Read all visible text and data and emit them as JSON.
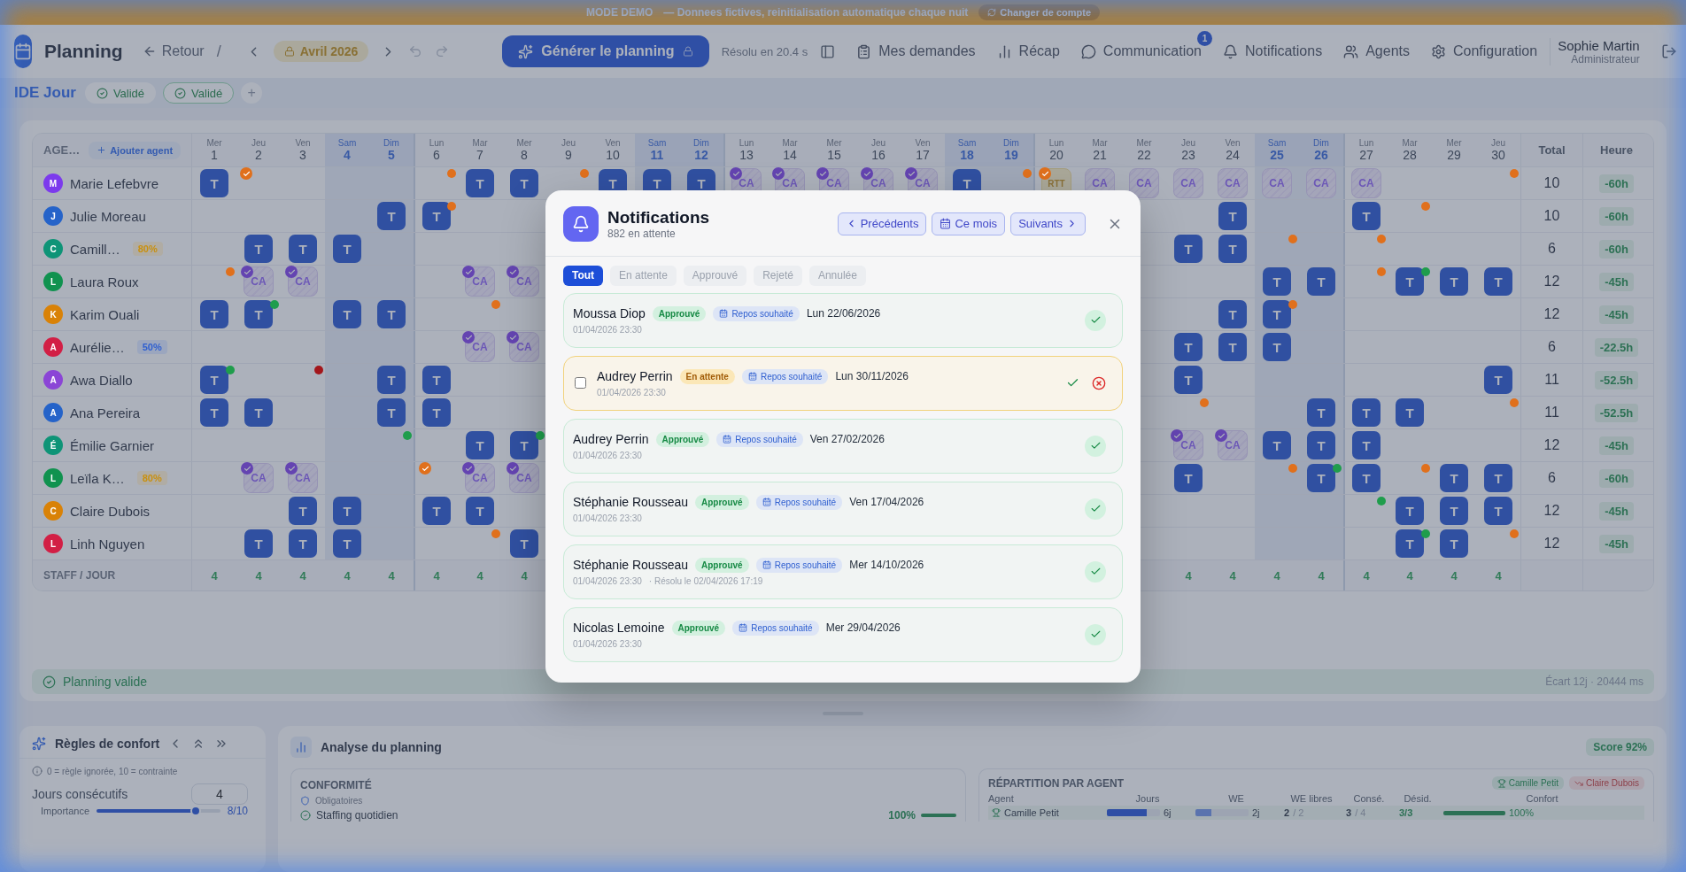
{
  "banner": {
    "mode": "MODE DEMO",
    "message": "— Donnees fictives, reinitialisation automatique chaque nuit",
    "switch_button": "Changer de compte"
  },
  "header": {
    "title": "Planning",
    "back": "Retour",
    "separator": "/",
    "month": "Avril",
    "year": "2026",
    "generate_button": "Générer le planning",
    "solve_time": "Résolu en 20.4 s",
    "nav": [
      {
        "kind": "requests",
        "label": "Mes demandes"
      },
      {
        "kind": "recap",
        "label": "Récap"
      },
      {
        "kind": "messages",
        "label": "Communication",
        "badge": "1"
      },
      {
        "kind": "notifications",
        "label": "Notifications"
      },
      {
        "kind": "agents",
        "label": "Agents"
      },
      {
        "kind": "settings",
        "label": "Configuration"
      }
    ],
    "user": {
      "name": "Sophie Martin",
      "role": "Administrateur"
    }
  },
  "team": {
    "name": "IDE Jour",
    "chips": [
      {
        "label": "Validé",
        "selected": false
      },
      {
        "label": "Validé",
        "selected": true
      }
    ],
    "add_button": "+"
  },
  "grid": {
    "agent_header": "AGE…",
    "add_agent": "Ajouter agent",
    "total_header": "Total",
    "hours_header": "Heure",
    "staff_label": "STAFF / JOUR",
    "days": [
      {
        "weekday": "Mer",
        "day": "1",
        "weekend": false
      },
      {
        "weekday": "Jeu",
        "day": "2",
        "weekend": false
      },
      {
        "weekday": "Ven",
        "day": "3",
        "weekend": false
      },
      {
        "weekday": "Sam",
        "day": "4",
        "weekend": true
      },
      {
        "weekday": "Dim",
        "day": "5",
        "weekend": true
      },
      {
        "weekday": "Lun",
        "day": "6",
        "weekend": false
      },
      {
        "weekday": "Mar",
        "day": "7",
        "weekend": false
      },
      {
        "weekday": "Mer",
        "day": "8",
        "weekend": false
      },
      {
        "weekday": "Jeu",
        "day": "9",
        "weekend": false
      },
      {
        "weekday": "Ven",
        "day": "10",
        "weekend": false
      },
      {
        "weekday": "Sam",
        "day": "11",
        "weekend": true
      },
      {
        "weekday": "Dim",
        "day": "12",
        "weekend": true
      },
      {
        "weekday": "Lun",
        "day": "13",
        "weekend": false
      },
      {
        "weekday": "Mar",
        "day": "14",
        "weekend": false
      },
      {
        "weekday": "Mer",
        "day": "15",
        "weekend": false
      },
      {
        "weekday": "Jeu",
        "day": "16",
        "weekend": false
      },
      {
        "weekday": "Ven",
        "day": "17",
        "weekend": false
      },
      {
        "weekday": "Sam",
        "day": "18",
        "weekend": true
      },
      {
        "weekday": "Dim",
        "day": "19",
        "weekend": true
      },
      {
        "weekday": "Lun",
        "day": "20",
        "weekend": false
      },
      {
        "weekday": "Mar",
        "day": "21",
        "weekend": false
      },
      {
        "weekday": "Mer",
        "day": "22",
        "weekend": false
      },
      {
        "weekday": "Jeu",
        "day": "23",
        "weekend": false
      },
      {
        "weekday": "Ven",
        "day": "24",
        "weekend": false
      },
      {
        "weekday": "Sam",
        "day": "25",
        "weekend": true
      },
      {
        "weekday": "Dim",
        "day": "26",
        "weekend": true
      },
      {
        "weekday": "Lun",
        "day": "27",
        "weekend": false
      },
      {
        "weekday": "Mar",
        "day": "28",
        "weekend": false
      },
      {
        "weekday": "Mer",
        "day": "29",
        "weekend": false
      },
      {
        "weekday": "Jeu",
        "day": "30",
        "weekend": false
      }
    ],
    "agents": [
      {
        "initial": "M",
        "color": "#7c3aed",
        "name": "Marie Lefebvre",
        "total": "10",
        "hours": "-60h",
        "cells": [
          {
            "kind": "work",
            "label": "T"
          },
          {
            "kind": "off",
            "dot": {
              "color": "#e0701c",
              "checked": true
            }
          },
          {
            "kind": "off"
          },
          {
            "kind": "off"
          },
          {
            "kind": "off"
          },
          {
            "kind": "off",
            "dot": {
              "color": "#e0701c",
              "checked": false
            }
          },
          {
            "kind": "work",
            "label": "T"
          },
          {
            "kind": "work",
            "label": "T"
          },
          {
            "kind": "off",
            "dot": {
              "color": "#e0701c",
              "checked": false
            }
          },
          {
            "kind": "work",
            "label": "T"
          },
          {
            "kind": "work",
            "label": "T"
          },
          {
            "kind": "work",
            "label": "T"
          },
          {
            "kind": "leave",
            "label": "CA",
            "approved": true
          },
          {
            "kind": "leave",
            "label": "CA",
            "approved": true
          },
          {
            "kind": "leave",
            "label": "CA",
            "approved": true
          },
          {
            "kind": "leave",
            "label": "CA",
            "approved": true
          },
          {
            "kind": "leave",
            "label": "CA",
            "approved": true
          },
          {
            "kind": "work",
            "label": "T"
          },
          {
            "kind": "off",
            "dot": {
              "color": "#e0701c",
              "checked": false
            }
          },
          {
            "kind": "rtt",
            "label": "RTT",
            "dot": {
              "color": "#e0701c",
              "checked": true
            }
          },
          {
            "kind": "leave",
            "label": "CA",
            "approved": false
          },
          {
            "kind": "leave",
            "label": "CA",
            "approved": false
          },
          {
            "kind": "leave",
            "label": "CA",
            "approved": false
          },
          {
            "kind": "leave",
            "label": "CA",
            "approved": false
          },
          {
            "kind": "leave",
            "label": "CA",
            "approved": false
          },
          {
            "kind": "leave",
            "label": "CA",
            "approved": false
          },
          {
            "kind": "leave",
            "label": "CA",
            "approved": false
          },
          {
            "kind": "off"
          },
          {
            "kind": "off"
          },
          {
            "kind": "off",
            "dot": {
              "color": "#e0701c",
              "checked": false
            }
          }
        ]
      },
      {
        "initial": "J",
        "color": "#2563c9",
        "name": "Julie Moreau",
        "total": "10",
        "hours": "-60h",
        "cells": [
          {
            "kind": "off"
          },
          {
            "kind": "off"
          },
          {
            "kind": "off"
          },
          {
            "kind": "off"
          },
          {
            "kind": "work",
            "label": "T"
          },
          {
            "kind": "work",
            "label": "T",
            "dot": {
              "color": "#e0701c",
              "checked": false
            }
          },
          {
            "kind": "off"
          },
          {
            "kind": "off"
          },
          {
            "kind": "covered"
          },
          {
            "kind": "covered"
          },
          {
            "kind": "covered"
          },
          {
            "kind": "covered"
          },
          {
            "kind": "covered"
          },
          {
            "kind": "covered"
          },
          {
            "kind": "covered"
          },
          {
            "kind": "covered"
          },
          {
            "kind": "covered"
          },
          {
            "kind": "covered"
          },
          {
            "kind": "covered"
          },
          {
            "kind": "covered"
          },
          {
            "kind": "covered"
          },
          {
            "kind": "covered"
          },
          {
            "kind": "off"
          },
          {
            "kind": "work",
            "label": "T"
          },
          {
            "kind": "off"
          },
          {
            "kind": "off"
          },
          {
            "kind": "work",
            "label": "T"
          },
          {
            "kind": "off",
            "dot": {
              "color": "#e0701c",
              "checked": false
            }
          },
          {
            "kind": "off"
          },
          {
            "kind": "off"
          }
        ]
      },
      {
        "initial": "C",
        "color": "#0e9477",
        "name": "Camill…",
        "rate": {
          "label": "80%",
          "color": "#c9900e"
        },
        "total": "6",
        "hours": "-60h",
        "cells": [
          {
            "kind": "off"
          },
          {
            "kind": "work",
            "label": "T"
          },
          {
            "kind": "work",
            "label": "T"
          },
          {
            "kind": "work",
            "label": "T"
          },
          {
            "kind": "off"
          },
          {
            "kind": "off"
          },
          {
            "kind": "off"
          },
          {
            "kind": "off"
          },
          {
            "kind": "covered"
          },
          {
            "kind": "covered"
          },
          {
            "kind": "covered"
          },
          {
            "kind": "covered"
          },
          {
            "kind": "covered"
          },
          {
            "kind": "covered"
          },
          {
            "kind": "covered"
          },
          {
            "kind": "covered"
          },
          {
            "kind": "covered"
          },
          {
            "kind": "covered"
          },
          {
            "kind": "covered"
          },
          {
            "kind": "covered"
          },
          {
            "kind": "covered"
          },
          {
            "kind": "covered"
          },
          {
            "kind": "work",
            "label": "T"
          },
          {
            "kind": "work",
            "label": "T"
          },
          {
            "kind": "off",
            "dot": {
              "color": "#e0701c",
              "checked": false
            }
          },
          {
            "kind": "off"
          },
          {
            "kind": "off",
            "dot": {
              "color": "#e0701c",
              "checked": false
            }
          },
          {
            "kind": "off"
          },
          {
            "kind": "off"
          },
          {
            "kind": "off"
          }
        ]
      },
      {
        "initial": "L",
        "color": "#10924f",
        "name": "Laura Roux",
        "total": "12",
        "hours": "-45h",
        "cells": [
          {
            "kind": "off",
            "dot": {
              "color": "#e0701c",
              "checked": false
            }
          },
          {
            "kind": "leave",
            "label": "CA",
            "approved": true
          },
          {
            "kind": "leave",
            "label": "CA",
            "approved": true
          },
          {
            "kind": "off"
          },
          {
            "kind": "off"
          },
          {
            "kind": "off"
          },
          {
            "kind": "leave",
            "label": "CA",
            "approved": true
          },
          {
            "kind": "leave",
            "label": "CA",
            "approved": true
          },
          {
            "kind": "covered"
          },
          {
            "kind": "covered"
          },
          {
            "kind": "covered"
          },
          {
            "kind": "covered"
          },
          {
            "kind": "covered"
          },
          {
            "kind": "covered"
          },
          {
            "kind": "covered"
          },
          {
            "kind": "covered"
          },
          {
            "kind": "covered"
          },
          {
            "kind": "covered"
          },
          {
            "kind": "covered"
          },
          {
            "kind": "covered"
          },
          {
            "kind": "covered"
          },
          {
            "kind": "covered"
          },
          {
            "kind": "off"
          },
          {
            "kind": "off"
          },
          {
            "kind": "work",
            "label": "T"
          },
          {
            "kind": "work",
            "label": "T"
          },
          {
            "kind": "off",
            "dot": {
              "color": "#e0701c",
              "checked": false
            }
          },
          {
            "kind": "work",
            "label": "T",
            "dot": {
              "color": "#1f9d4c",
              "checked": false
            }
          },
          {
            "kind": "work",
            "label": "T"
          },
          {
            "kind": "work",
            "label": "T"
          }
        ]
      },
      {
        "initial": "K",
        "color": "#d98207",
        "name": "Karim Ouali",
        "total": "12",
        "hours": "-45h",
        "cells": [
          {
            "kind": "work",
            "label": "T"
          },
          {
            "kind": "work",
            "label": "T",
            "dot": {
              "color": "#1f9d4c",
              "checked": false
            }
          },
          {
            "kind": "off"
          },
          {
            "kind": "work",
            "label": "T"
          },
          {
            "kind": "work",
            "label": "T"
          },
          {
            "kind": "off"
          },
          {
            "kind": "off",
            "dot": {
              "color": "#e0701c",
              "checked": false
            }
          },
          {
            "kind": "off"
          },
          {
            "kind": "covered"
          },
          {
            "kind": "covered"
          },
          {
            "kind": "covered"
          },
          {
            "kind": "covered"
          },
          {
            "kind": "covered"
          },
          {
            "kind": "covered"
          },
          {
            "kind": "covered"
          },
          {
            "kind": "covered"
          },
          {
            "kind": "covered"
          },
          {
            "kind": "covered"
          },
          {
            "kind": "covered"
          },
          {
            "kind": "covered"
          },
          {
            "kind": "covered"
          },
          {
            "kind": "covered"
          },
          {
            "kind": "off"
          },
          {
            "kind": "work",
            "label": "T"
          },
          {
            "kind": "work",
            "label": "T",
            "dot": {
              "color": "#e0701c",
              "checked": false
            }
          },
          {
            "kind": "off"
          },
          {
            "kind": "off"
          },
          {
            "kind": "off"
          },
          {
            "kind": "off"
          },
          {
            "kind": "off"
          }
        ]
      },
      {
        "initial": "A",
        "color": "#d21f45",
        "name": "Aurélie…",
        "rate": {
          "label": "50%",
          "color": "#2f5fd0"
        },
        "total": "6",
        "hours": "-22.5h",
        "cells": [
          {
            "kind": "off"
          },
          {
            "kind": "off"
          },
          {
            "kind": "off"
          },
          {
            "kind": "off"
          },
          {
            "kind": "off"
          },
          {
            "kind": "off"
          },
          {
            "kind": "leave",
            "label": "CA",
            "approved": true
          },
          {
            "kind": "leave",
            "label": "CA",
            "approved": true
          },
          {
            "kind": "covered"
          },
          {
            "kind": "covered"
          },
          {
            "kind": "covered"
          },
          {
            "kind": "covered"
          },
          {
            "kind": "covered"
          },
          {
            "kind": "covered"
          },
          {
            "kind": "covered"
          },
          {
            "kind": "covered"
          },
          {
            "kind": "covered"
          },
          {
            "kind": "covered"
          },
          {
            "kind": "covered"
          },
          {
            "kind": "covered"
          },
          {
            "kind": "covered"
          },
          {
            "kind": "covered"
          },
          {
            "kind": "work",
            "label": "T"
          },
          {
            "kind": "work",
            "label": "T"
          },
          {
            "kind": "work",
            "label": "T"
          },
          {
            "kind": "off"
          },
          {
            "kind": "off"
          },
          {
            "kind": "off"
          },
          {
            "kind": "off"
          },
          {
            "kind": "off"
          }
        ]
      },
      {
        "initial": "A",
        "color": "#8b45d6",
        "name": "Awa Diallo",
        "total": "11",
        "hours": "-52.5h",
        "cells": [
          {
            "kind": "work",
            "label": "T",
            "dot": {
              "color": "#1f9d4c",
              "checked": false
            }
          },
          {
            "kind": "off"
          },
          {
            "kind": "off",
            "dot": {
              "color": "#a3161b",
              "checked": false
            }
          },
          {
            "kind": "off"
          },
          {
            "kind": "work",
            "label": "T"
          },
          {
            "kind": "work",
            "label": "T"
          },
          {
            "kind": "off"
          },
          {
            "kind": "off"
          },
          {
            "kind": "covered"
          },
          {
            "kind": "covered"
          },
          {
            "kind": "covered"
          },
          {
            "kind": "covered"
          },
          {
            "kind": "covered"
          },
          {
            "kind": "covered"
          },
          {
            "kind": "covered"
          },
          {
            "kind": "covered"
          },
          {
            "kind": "covered"
          },
          {
            "kind": "covered"
          },
          {
            "kind": "covered"
          },
          {
            "kind": "covered"
          },
          {
            "kind": "covered"
          },
          {
            "kind": "covered"
          },
          {
            "kind": "work",
            "label": "T"
          },
          {
            "kind": "off"
          },
          {
            "kind": "off"
          },
          {
            "kind": "off"
          },
          {
            "kind": "off"
          },
          {
            "kind": "off"
          },
          {
            "kind": "off"
          },
          {
            "kind": "work",
            "label": "T"
          }
        ]
      },
      {
        "initial": "A",
        "color": "#2563c9",
        "name": "Ana Pereira",
        "total": "11",
        "hours": "-52.5h",
        "cells": [
          {
            "kind": "work",
            "label": "T"
          },
          {
            "kind": "work",
            "label": "T"
          },
          {
            "kind": "off"
          },
          {
            "kind": "off"
          },
          {
            "kind": "work",
            "label": "T"
          },
          {
            "kind": "work",
            "label": "T"
          },
          {
            "kind": "off"
          },
          {
            "kind": "off"
          },
          {
            "kind": "covered"
          },
          {
            "kind": "covered"
          },
          {
            "kind": "covered"
          },
          {
            "kind": "covered"
          },
          {
            "kind": "covered"
          },
          {
            "kind": "covered"
          },
          {
            "kind": "covered"
          },
          {
            "kind": "covered"
          },
          {
            "kind": "covered"
          },
          {
            "kind": "covered"
          },
          {
            "kind": "covered"
          },
          {
            "kind": "covered"
          },
          {
            "kind": "covered"
          },
          {
            "kind": "covered"
          },
          {
            "kind": "off",
            "dot": {
              "color": "#e0701c",
              "checked": false
            }
          },
          {
            "kind": "off"
          },
          {
            "kind": "off"
          },
          {
            "kind": "work",
            "label": "T"
          },
          {
            "kind": "work",
            "label": "T"
          },
          {
            "kind": "work",
            "label": "T"
          },
          {
            "kind": "off"
          },
          {
            "kind": "off",
            "dot": {
              "color": "#e0701c",
              "checked": false
            }
          }
        ]
      },
      {
        "initial": "É",
        "color": "#0e9477",
        "name": "Émilie Garnier",
        "total": "12",
        "hours": "-45h",
        "cells": [
          {
            "kind": "off"
          },
          {
            "kind": "off"
          },
          {
            "kind": "off"
          },
          {
            "kind": "off"
          },
          {
            "kind": "off",
            "dot": {
              "color": "#1f9d4c",
              "checked": false
            }
          },
          {
            "kind": "off"
          },
          {
            "kind": "work",
            "label": "T"
          },
          {
            "kind": "work",
            "label": "T",
            "dot": {
              "color": "#1f9d4c",
              "checked": false
            }
          },
          {
            "kind": "covered"
          },
          {
            "kind": "covered"
          },
          {
            "kind": "covered"
          },
          {
            "kind": "covered"
          },
          {
            "kind": "covered"
          },
          {
            "kind": "covered"
          },
          {
            "kind": "covered"
          },
          {
            "kind": "covered"
          },
          {
            "kind": "covered"
          },
          {
            "kind": "covered"
          },
          {
            "kind": "covered"
          },
          {
            "kind": "covered"
          },
          {
            "kind": "covered"
          },
          {
            "kind": "covered"
          },
          {
            "kind": "leave",
            "label": "CA",
            "approved": true
          },
          {
            "kind": "leave",
            "label": "CA",
            "approved": true
          },
          {
            "kind": "work",
            "label": "T"
          },
          {
            "kind": "work",
            "label": "T"
          },
          {
            "kind": "work",
            "label": "T"
          },
          {
            "kind": "off"
          },
          {
            "kind": "off"
          },
          {
            "kind": "off"
          }
        ]
      },
      {
        "initial": "L",
        "color": "#10924f",
        "name": "Leïla K…",
        "rate": {
          "label": "80%",
          "color": "#c9900e"
        },
        "total": "6",
        "hours": "-60h",
        "cells": [
          {
            "kind": "off"
          },
          {
            "kind": "leave",
            "label": "CA",
            "approved": true
          },
          {
            "kind": "leave",
            "label": "CA",
            "approved": true
          },
          {
            "kind": "off"
          },
          {
            "kind": "off"
          },
          {
            "kind": "off",
            "dot": {
              "color": "#e0701c",
              "checked": true
            }
          },
          {
            "kind": "leave",
            "label": "CA",
            "approved": true
          },
          {
            "kind": "leave",
            "label": "CA",
            "approved": true
          },
          {
            "kind": "covered"
          },
          {
            "kind": "covered"
          },
          {
            "kind": "covered"
          },
          {
            "kind": "covered"
          },
          {
            "kind": "covered"
          },
          {
            "kind": "covered"
          },
          {
            "kind": "covered"
          },
          {
            "kind": "covered"
          },
          {
            "kind": "covered"
          },
          {
            "kind": "covered"
          },
          {
            "kind": "covered"
          },
          {
            "kind": "covered"
          },
          {
            "kind": "covered"
          },
          {
            "kind": "covered"
          },
          {
            "kind": "work",
            "label": "T"
          },
          {
            "kind": "off"
          },
          {
            "kind": "off",
            "dot": {
              "color": "#e0701c",
              "checked": false
            }
          },
          {
            "kind": "work",
            "label": "T",
            "dot": {
              "color": "#1f9d4c",
              "checked": false
            }
          },
          {
            "kind": "work",
            "label": "T"
          },
          {
            "kind": "off",
            "dot": {
              "color": "#e0701c",
              "checked": false
            }
          },
          {
            "kind": "work",
            "label": "T"
          },
          {
            "kind": "work",
            "label": "T"
          }
        ]
      },
      {
        "initial": "C",
        "color": "#d98207",
        "name": "Claire Dubois",
        "total": "12",
        "hours": "-45h",
        "cells": [
          {
            "kind": "off"
          },
          {
            "kind": "off"
          },
          {
            "kind": "work",
            "label": "T"
          },
          {
            "kind": "work",
            "label": "T"
          },
          {
            "kind": "off"
          },
          {
            "kind": "work",
            "label": "T"
          },
          {
            "kind": "work",
            "label": "T"
          },
          {
            "kind": "off"
          },
          {
            "kind": "covered"
          },
          {
            "kind": "covered"
          },
          {
            "kind": "covered"
          },
          {
            "kind": "covered"
          },
          {
            "kind": "covered"
          },
          {
            "kind": "covered"
          },
          {
            "kind": "covered"
          },
          {
            "kind": "covered"
          },
          {
            "kind": "covered"
          },
          {
            "kind": "covered"
          },
          {
            "kind": "covered"
          },
          {
            "kind": "covered"
          },
          {
            "kind": "covered"
          },
          {
            "kind": "covered"
          },
          {
            "kind": "off"
          },
          {
            "kind": "off"
          },
          {
            "kind": "off"
          },
          {
            "kind": "off"
          },
          {
            "kind": "off",
            "dot": {
              "color": "#1f9d4c",
              "checked": false
            }
          },
          {
            "kind": "work",
            "label": "T"
          },
          {
            "kind": "work",
            "label": "T"
          },
          {
            "kind": "work",
            "label": "T"
          }
        ]
      },
      {
        "initial": "L",
        "color": "#d21f45",
        "name": "Linh Nguyen",
        "total": "12",
        "hours": "-45h",
        "cells": [
          {
            "kind": "off"
          },
          {
            "kind": "work",
            "label": "T"
          },
          {
            "kind": "work",
            "label": "T"
          },
          {
            "kind": "work",
            "label": "T"
          },
          {
            "kind": "off"
          },
          {
            "kind": "off"
          },
          {
            "kind": "off",
            "dot": {
              "color": "#e0701c",
              "checked": false
            }
          },
          {
            "kind": "work",
            "label": "T"
          },
          {
            "kind": "covered"
          },
          {
            "kind": "covered"
          },
          {
            "kind": "covered"
          },
          {
            "kind": "covered"
          },
          {
            "kind": "covered"
          },
          {
            "kind": "covered"
          },
          {
            "kind": "covered"
          },
          {
            "kind": "covered"
          },
          {
            "kind": "covered"
          },
          {
            "kind": "covered"
          },
          {
            "kind": "covered"
          },
          {
            "kind": "covered"
          },
          {
            "kind": "covered"
          },
          {
            "kind": "covered"
          },
          {
            "kind": "off"
          },
          {
            "kind": "off"
          },
          {
            "kind": "off"
          },
          {
            "kind": "off"
          },
          {
            "kind": "off"
          },
          {
            "kind": "work",
            "label": "T",
            "dot": {
              "color": "#1f9d4c",
              "checked": false
            }
          },
          {
            "kind": "work",
            "label": "T"
          },
          {
            "kind": "off",
            "dot": {
              "color": "#e0701c",
              "checked": false
            }
          }
        ]
      }
    ],
    "staff": [
      {
        "kind": "count",
        "value": "4"
      },
      {
        "kind": "count",
        "value": "4"
      },
      {
        "kind": "count",
        "value": "4"
      },
      {
        "kind": "count",
        "value": "4"
      },
      {
        "kind": "count",
        "value": "4"
      },
      {
        "kind": "count",
        "value": "4"
      },
      {
        "kind": "count",
        "value": "4"
      },
      {
        "kind": "count",
        "value": "4"
      },
      {
        "kind": "covered"
      },
      {
        "kind": "covered"
      },
      {
        "kind": "covered"
      },
      {
        "kind": "covered"
      },
      {
        "kind": "covered"
      },
      {
        "kind": "covered"
      },
      {
        "kind": "covered"
      },
      {
        "kind": "covered"
      },
      {
        "kind": "covered"
      },
      {
        "kind": "covered"
      },
      {
        "kind": "covered"
      },
      {
        "kind": "covered"
      },
      {
        "kind": "covered"
      },
      {
        "kind": "covered"
      },
      {
        "kind": "count",
        "value": "4"
      },
      {
        "kind": "count",
        "value": "4"
      },
      {
        "kind": "count",
        "value": "4"
      },
      {
        "kind": "count",
        "value": "4"
      },
      {
        "kind": "count",
        "value": "4"
      },
      {
        "kind": "count",
        "value": "4"
      },
      {
        "kind": "count",
        "value": "4"
      },
      {
        "kind": "count",
        "value": "4"
      }
    ]
  },
  "status": {
    "label": "Planning valide",
    "detail": "Écart 12j · 20444 ms"
  },
  "comfort": {
    "title": "Règles de confort",
    "hint": "0 = règle ignorée, 10 = contrainte",
    "rule": "Jours consécutifs",
    "value": "4",
    "importance_label": "Importance",
    "importance": {
      "level": 0.8
    },
    "importance_value": "8/10"
  },
  "analysis": {
    "title": "Analyse du planning",
    "score": "Score 92%",
    "compliance": {
      "title": "CONFORMITÉ",
      "group": "Obligatoires",
      "rows": [
        {
          "label": "Staffing quotidien",
          "value": "100%",
          "level": 1
        }
      ]
    },
    "distribution": {
      "title": "RÉPARTITION PAR AGENT",
      "best": "Camille Petit",
      "worst": "Claire Dubois",
      "columns": [
        "Agent",
        "Jours",
        "WE",
        "WE libres",
        "Consé.",
        "Désid.",
        "Confort"
      ],
      "rows": [
        {
          "name": "Camille Petit",
          "days": {
            "level": 0.75,
            "value": "6j"
          },
          "weekends": {
            "level": 0.3,
            "value": "2j"
          },
          "free_we": {
            "value": "2",
            "max": "/ 2"
          },
          "consecutive": {
            "value": "3",
            "max": "/ 4"
          },
          "wishes": "3/3",
          "comfort": {
            "level": 1,
            "value": "100%"
          }
        }
      ]
    }
  },
  "modal": {
    "title": "Notifications",
    "subtitle": "882 en attente",
    "prev_button": "Précédents",
    "month_button": "Ce mois",
    "next_button": "Suivants",
    "tabs": [
      {
        "label": "Tout",
        "selected": true
      },
      {
        "label": "En attente",
        "selected": false
      },
      {
        "label": "Approuvé",
        "selected": false
      },
      {
        "label": "Rejeté",
        "selected": false
      },
      {
        "label": "Annulée",
        "selected": false
      }
    ],
    "items": [
      {
        "kind": "approved",
        "name": "Moussa Diop",
        "status": "Approuvé",
        "type": "Repos souhaité",
        "date": "Lun 22/06/2026",
        "created": "01/04/2026 23:30"
      },
      {
        "kind": "pending",
        "checked": false,
        "name": "Audrey Perrin",
        "status": "En attente",
        "type": "Repos souhaité",
        "date": "Lun 30/11/2026",
        "created": "01/04/2026 23:30"
      },
      {
        "kind": "approved",
        "name": "Audrey Perrin",
        "status": "Approuvé",
        "type": "Repos souhaité",
        "date": "Ven 27/02/2026",
        "created": "01/04/2026 23:30"
      },
      {
        "kind": "approved",
        "name": "Stéphanie Rousseau",
        "status": "Approuvé",
        "type": "Repos souhaité",
        "date": "Ven 17/04/2026",
        "created": "01/04/2026 23:30"
      },
      {
        "kind": "approved",
        "name": "Stéphanie Rousseau",
        "status": "Approuvé",
        "type": "Repos souhaité",
        "date": "Mer 14/10/2026",
        "created": "01/04/2026 23:30",
        "resolved": "· Résolu le 02/04/2026 17:19"
      },
      {
        "kind": "approved",
        "name": "Nicolas Lemoine",
        "status": "Approuvé",
        "type": "Repos souhaité",
        "date": "Mer 29/04/2026",
        "created": "01/04/2026 23:30"
      }
    ]
  }
}
